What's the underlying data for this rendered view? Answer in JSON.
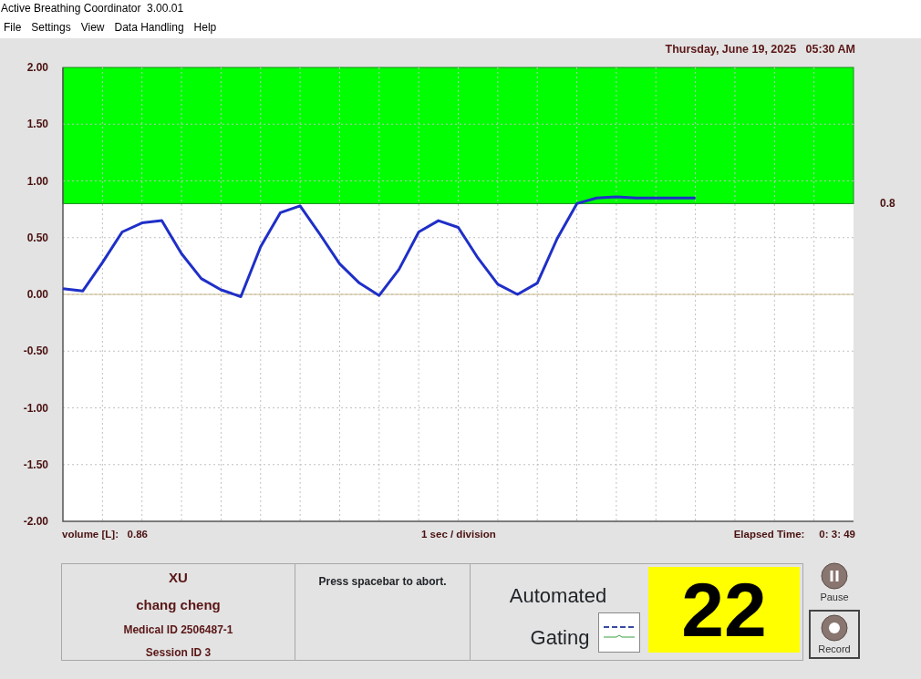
{
  "window": {
    "title": "Active Breathing Coordinator  3.00.01"
  },
  "menu": [
    "File",
    "Settings",
    "View",
    "Data Handling",
    "Help"
  ],
  "datetime": "Thursday, June 19, 2025   05:30 AM",
  "breathing_chart": {
    "threshold_label": "0.8",
    "chart_data": {
      "type": "line",
      "ylim": [
        -2,
        2
      ],
      "grid": true,
      "bands": [
        {
          "axis": "y",
          "from": 0.8,
          "to": 2,
          "color": "#00ff00"
        }
      ],
      "ref_lines": [
        {
          "axis": "y",
          "value": 0,
          "color": "#c8b88a"
        }
      ],
      "yticks": [
        {
          "value": 2,
          "label": "2.00"
        },
        {
          "value": 1.5,
          "label": "1.50"
        },
        {
          "value": 1,
          "label": "1.00"
        },
        {
          "value": 0.5,
          "label": "0.50"
        },
        {
          "value": 0,
          "label": "0.00"
        },
        {
          "value": -0.5,
          "label": "-0.50"
        },
        {
          "value": -1,
          "label": "-1.00"
        },
        {
          "value": -1.5,
          "label": "-1.50"
        },
        {
          "value": -2,
          "label": "-2.00"
        }
      ],
      "categories": [
        null,
        null,
        null,
        null,
        null,
        null,
        null,
        null,
        null,
        null,
        null,
        null,
        null,
        null,
        null,
        null,
        null,
        null,
        null,
        null,
        null,
        null,
        null,
        null,
        null,
        null,
        null,
        null,
        null,
        null,
        null,
        null,
        null,
        null,
        null,
        null,
        null,
        null,
        null,
        null,
        null
      ],
      "series": [
        {
          "color": "#1f2fc8",
          "values": [
            0.05,
            0.03,
            0.28,
            0.55,
            0.63,
            0.65,
            0.36,
            0.14,
            0.04,
            -0.02,
            0.42,
            0.72,
            0.78,
            0.53,
            0.27,
            0.1,
            -0.01,
            0.22,
            0.55,
            0.65,
            0.59,
            0.32,
            0.09,
            0.0,
            0.1,
            0.49,
            0.8,
            0.85,
            0.86,
            0.85,
            0.85,
            0.85,
            0.85,
            null,
            null,
            null,
            null,
            null,
            null,
            null,
            null
          ]
        }
      ]
    }
  },
  "captions": {
    "volume": "volume [L]:   0.86",
    "scale": "1 sec / division",
    "elapsed": "Elapsed Time:     0: 3: 49"
  },
  "patient": {
    "surname": "XU",
    "given_name": "chang cheng",
    "medical_id": "Medical ID 2506487-1",
    "session_id": "Session ID 3"
  },
  "message": "Press spacebar to abort.",
  "mode": {
    "label_1": "Automated",
    "label_2": "Gating",
    "counter": "22"
  },
  "buttons": [
    {
      "label": "Pause",
      "kind": "pause",
      "focused": false
    },
    {
      "label": "Record",
      "kind": "record",
      "focused": true
    }
  ]
}
